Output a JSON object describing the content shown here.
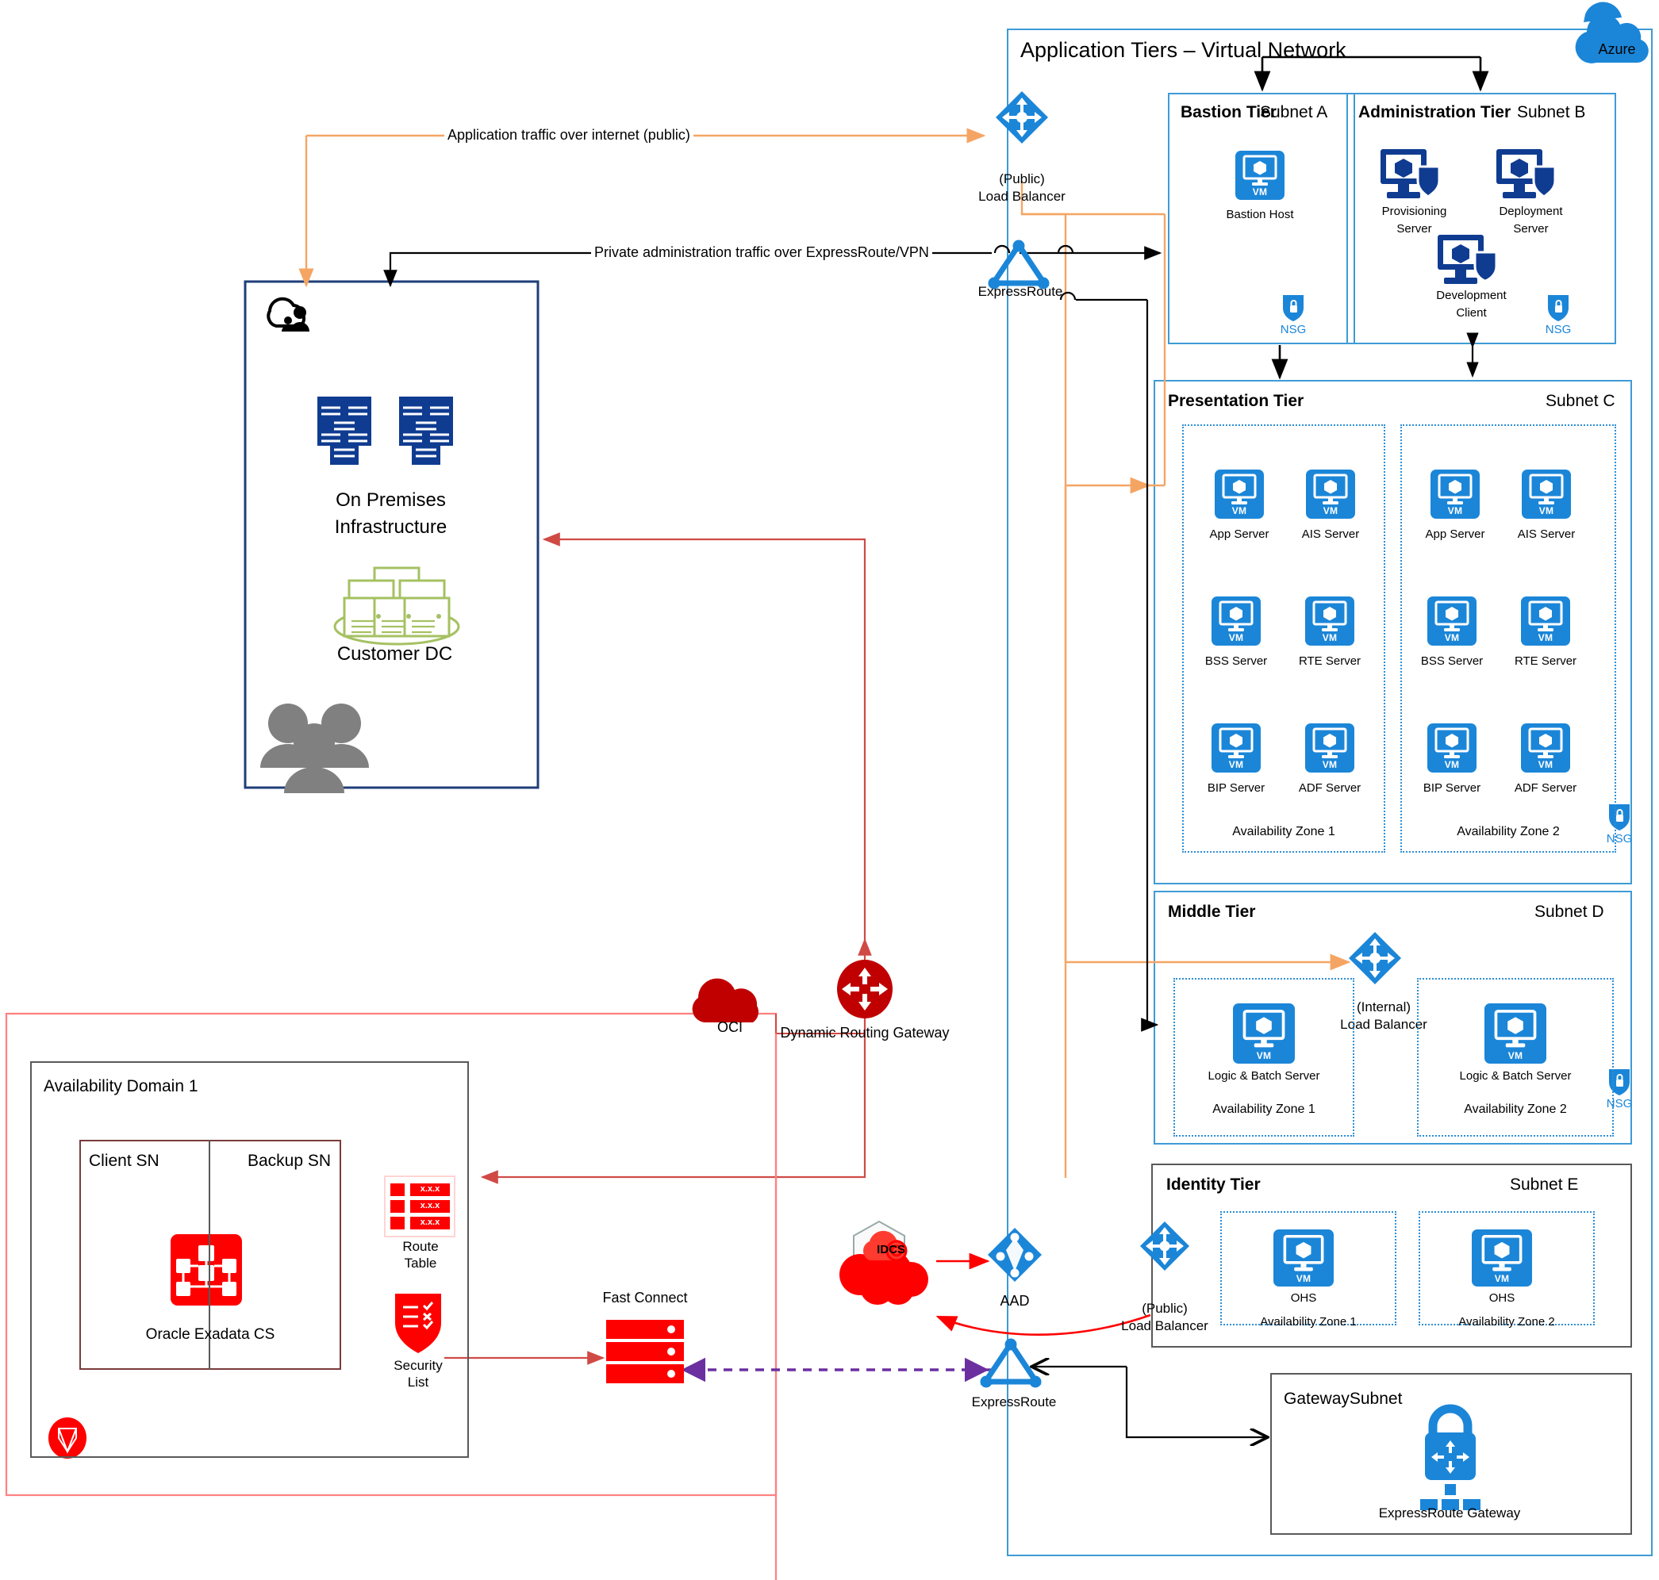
{
  "cloud_labels": {
    "azure": "Azure",
    "oci": "OCI"
  },
  "vnet": {
    "title": "Application Tiers – Virtual Network"
  },
  "connectors": {
    "public_traffic": "Application traffic over internet (public)",
    "private_admin": "Private administration traffic over ExpressRoute/VPN",
    "public_lb_top": {
      "line1": "(Public)",
      "line2": "Load Balancer"
    },
    "expressroute_top": "ExpressRoute",
    "expressroute_bottom": "ExpressRoute",
    "internal_lb": {
      "line1": "(Internal)",
      "line2": "Load Balancer"
    },
    "public_lb_identity": {
      "line1": "(Public)",
      "line2": "Load Balancer"
    },
    "drg": "Dynamic Routing Gateway",
    "fast_connect": "Fast Connect",
    "aad": "AAD",
    "idcs": "IDCS"
  },
  "onprem": {
    "title_line1": "On Premises",
    "title_line2": "Infrastructure",
    "customer_dc": "Customer DC"
  },
  "bastion_tier": {
    "title": "Bastion Tier",
    "subnet": "Subnet A",
    "nsg": "NSG",
    "servers": [
      {
        "label": "Bastion Host",
        "icon": "vm-icon"
      }
    ]
  },
  "admin_tier": {
    "title": "Administration Tier",
    "subnet": "Subnet B",
    "nsg": "NSG",
    "servers": [
      {
        "line1": "Provisioning",
        "line2": "Server",
        "icon": "secure-vm-icon"
      },
      {
        "line1": "Deployment",
        "line2": "Server",
        "icon": "secure-vm-icon"
      },
      {
        "line1": "Development",
        "line2": "Client",
        "icon": "secure-vm-icon"
      }
    ]
  },
  "presentation_tier": {
    "title": "Presentation Tier",
    "subnet": "Subnet C",
    "nsg": "NSG",
    "zones": [
      {
        "name": "Availability Zone 1",
        "servers": [
          "App Server",
          "AIS Server",
          "BSS Server",
          "RTE Server",
          "BIP Server",
          "ADF Server"
        ]
      },
      {
        "name": "Availability Zone 2",
        "servers": [
          "App Server",
          "AIS Server",
          "BSS Server",
          "RTE Server",
          "BIP Server",
          "ADF Server"
        ]
      }
    ]
  },
  "middle_tier": {
    "title": "Middle Tier",
    "subnet": "Subnet D",
    "nsg": "NSG",
    "zones": [
      {
        "name": "Availability Zone 1",
        "server": "Logic & Batch Server"
      },
      {
        "name": "Availability Zone 2",
        "server": "Logic & Batch Server"
      }
    ]
  },
  "identity_tier": {
    "title": "Identity Tier",
    "subnet": "Subnet E",
    "zones": [
      {
        "name": "Availability Zone 1",
        "server": "OHS"
      },
      {
        "name": "Availability Zone 2",
        "server": "OHS"
      }
    ]
  },
  "gateway_subnet": {
    "title": "GatewaySubnet",
    "gateway_label": "ExpressRoute Gateway"
  },
  "oci_region": {
    "availability_domain": "Availability Domain 1",
    "client_sn": "Client SN",
    "backup_sn": "Backup SN",
    "exadata": "Oracle Exadata CS",
    "route_table": {
      "line1": "Route",
      "line2": "Table"
    },
    "security_list": {
      "line1": "Security",
      "line2": "List"
    },
    "route_table_rows": [
      "x.x.x",
      "x.x.x",
      "x.x.x"
    ]
  },
  "colors": {
    "azure_blue": "#1B86D8",
    "azure_dark_blue": "#0F3C91",
    "orange": "#F5A563",
    "oracle_red": "#FF0000",
    "dark_red": "#C00000",
    "purple": "#6B2FA0",
    "green": "#A5C162",
    "gray": "#808080",
    "black": "#000000"
  }
}
